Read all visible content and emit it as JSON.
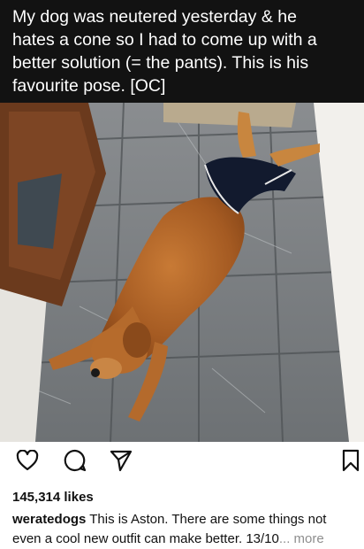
{
  "overlay": {
    "lines": [
      "My dog was neutered yesterday & he",
      "hates a cone so I had to come up with a",
      "better solution (= the pants). This is his",
      "favourite pose. [OC]"
    ]
  },
  "actions": {
    "like_icon": "heart-icon",
    "comment_icon": "comment-icon",
    "share_icon": "send-icon",
    "save_icon": "bookmark-icon"
  },
  "post": {
    "likes": "145,314 likes",
    "username": "weratedogs",
    "caption_line1": "This is Aston. There are some things not",
    "caption_line2": "even a cool new outfit can make better. 13/10",
    "more_label": "... more"
  }
}
